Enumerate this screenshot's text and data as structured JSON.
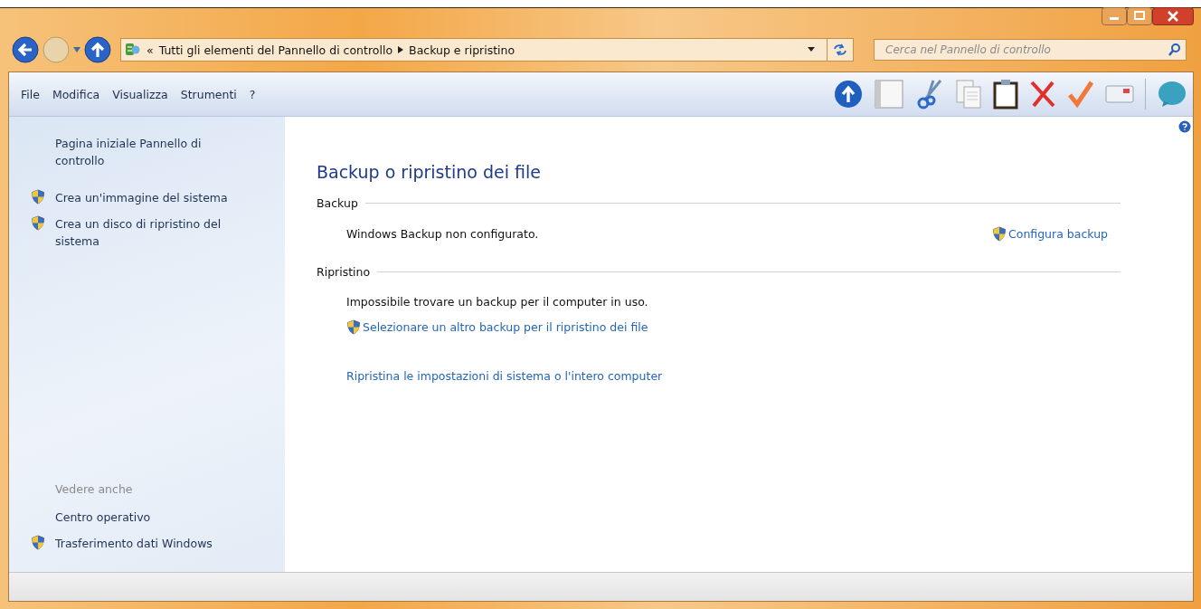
{
  "navigation": {
    "address_prefix": "«",
    "breadcrumb": [
      "Tutti gli elementi del Pannello di controllo",
      "Backup e ripristino"
    ],
    "search": {
      "placeholder": "Cerca nel Pannello di controllo"
    }
  },
  "menu": [
    "File",
    "Modifica",
    "Visualizza",
    "Strumenti",
    "?"
  ],
  "sidebar": {
    "items": [
      {
        "label": "Pagina iniziale Pannello di controllo",
        "kind": "plain"
      },
      {
        "label": "Crea un'immagine del sistema",
        "kind": "shield"
      },
      {
        "label": "Crea un disco di ripristino del sistema",
        "kind": "shield"
      }
    ],
    "see_also": {
      "heading": "Vedere anche",
      "items": [
        {
          "label": "Centro operativo",
          "kind": "plain"
        },
        {
          "label": "Trasferimento dati Windows",
          "kind": "shield"
        }
      ]
    }
  },
  "content": {
    "title": "Backup o ripristino dei file",
    "sections": [
      {
        "heading": "Backup",
        "status": "Windows Backup non configurato.",
        "action": {
          "label": "Configura backup",
          "kind": "shield"
        }
      },
      {
        "heading": "Ripristino",
        "status": "Impossibile trovare un backup per il computer in uso.",
        "links": [
          {
            "label": "Selezionare un altro backup per il ripristino dei file",
            "kind": "shield"
          },
          {
            "label": "Ripristina le impostazioni di sistema o l'intero computer",
            "kind": "plain"
          }
        ]
      }
    ]
  }
}
